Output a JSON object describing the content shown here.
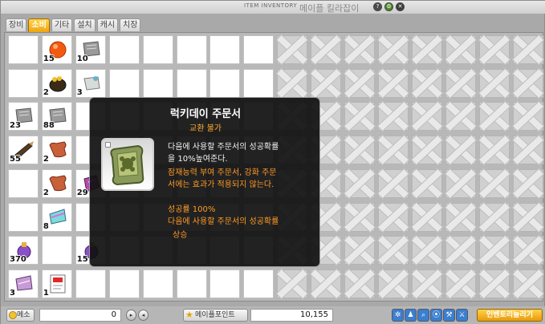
{
  "window": {
    "title": "ITEM INVENTORY",
    "owner": "메이플 킬라잡이",
    "help_symbol": "?",
    "settings_symbol": "⚙",
    "close_symbol": "✕"
  },
  "tabs": [
    {
      "label": "장비",
      "active": false
    },
    {
      "label": "소비",
      "active": true
    },
    {
      "label": "기타",
      "active": false
    },
    {
      "label": "설치",
      "active": false
    },
    {
      "label": "캐시",
      "active": false
    },
    {
      "label": "치장",
      "active": false
    }
  ],
  "items": [
    {
      "qty": "15",
      "icon": "orange-potion-icon"
    },
    {
      "qty": "10",
      "icon": "scroll-icon"
    },
    {
      "qty": "2",
      "icon": "gold-pot-icon"
    },
    {
      "qty": "3",
      "icon": "cloth-bag-icon"
    },
    {
      "qty": "23",
      "icon": "scroll-icon"
    },
    {
      "qty": "88",
      "icon": "scroll-icon"
    },
    {
      "qty": "55",
      "icon": "bullet-icon"
    },
    {
      "qty": "2",
      "icon": "brown-scroll-icon"
    },
    {
      "qty": "2",
      "icon": "brown-scroll-icon"
    },
    {
      "qty": "29",
      "icon": "purple-bag-icon"
    },
    {
      "qty": "8",
      "icon": "rainbow-scroll-icon"
    },
    {
      "qty": "370",
      "icon": "purple-potion-icon"
    },
    {
      "qty": "15",
      "icon": "purple-potion-icon"
    },
    {
      "qty": "3",
      "icon": "pink-scroll-icon"
    },
    {
      "qty": "1",
      "icon": "coupon-icon"
    }
  ],
  "tooltip": {
    "title": "럭키데이 주문서",
    "trade": "교환 불가",
    "icon": "lucky-day-scroll-icon",
    "desc1": "다음에 사용할 주문서의 성공확률",
    "desc2": "을 10%높여준다.",
    "warn1": "잠재능력 부여 주문서, 강화 주문",
    "warn2": "서에는 효과가 적용되지 않는다.",
    "rate": "성공률 100%",
    "effect1": "다음에 사용할 주문서의 성공확률",
    "effect2": "상승"
  },
  "bottom": {
    "meso_label": "메소",
    "meso_value": "0",
    "maple_points_label": "메이플포인트",
    "maple_points_value": "10,155",
    "expand_label": "인벤토리늘리기",
    "arrow_right": "▸",
    "arrow_left": "◂",
    "tool_icons": [
      "✲",
      "♟",
      "⌕",
      "⦿",
      "⚒",
      "⚔",
      "≡"
    ]
  },
  "colors": {
    "accent": "#f0a50f",
    "tooltip_orange": "#ff9a26"
  }
}
